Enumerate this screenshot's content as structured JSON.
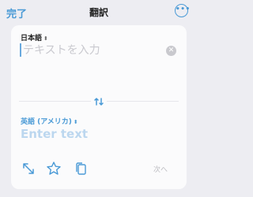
{
  "header": {
    "done_label": "完了",
    "title": "翻訳",
    "more_icon": "ellipsis-circle-icon"
  },
  "source": {
    "language": "日本語",
    "chevron": "⌃⌄",
    "placeholder": "テキストを入力",
    "value": "",
    "clear_icon": "clear-circle-icon"
  },
  "swap_icon": "swap-arrows-icon",
  "target": {
    "language": "英語 (アメリカ)",
    "chevron": "⌃⌄",
    "placeholder": "Enter text"
  },
  "toolbar": {
    "expand_icon": "expand-arrows-icon",
    "favorite_icon": "star-icon",
    "copy_icon": "copy-icon",
    "next_label": "次へ"
  },
  "colors": {
    "accent": "#4a9ad6",
    "background": "#ededf2",
    "card": "#fbfbfc"
  }
}
